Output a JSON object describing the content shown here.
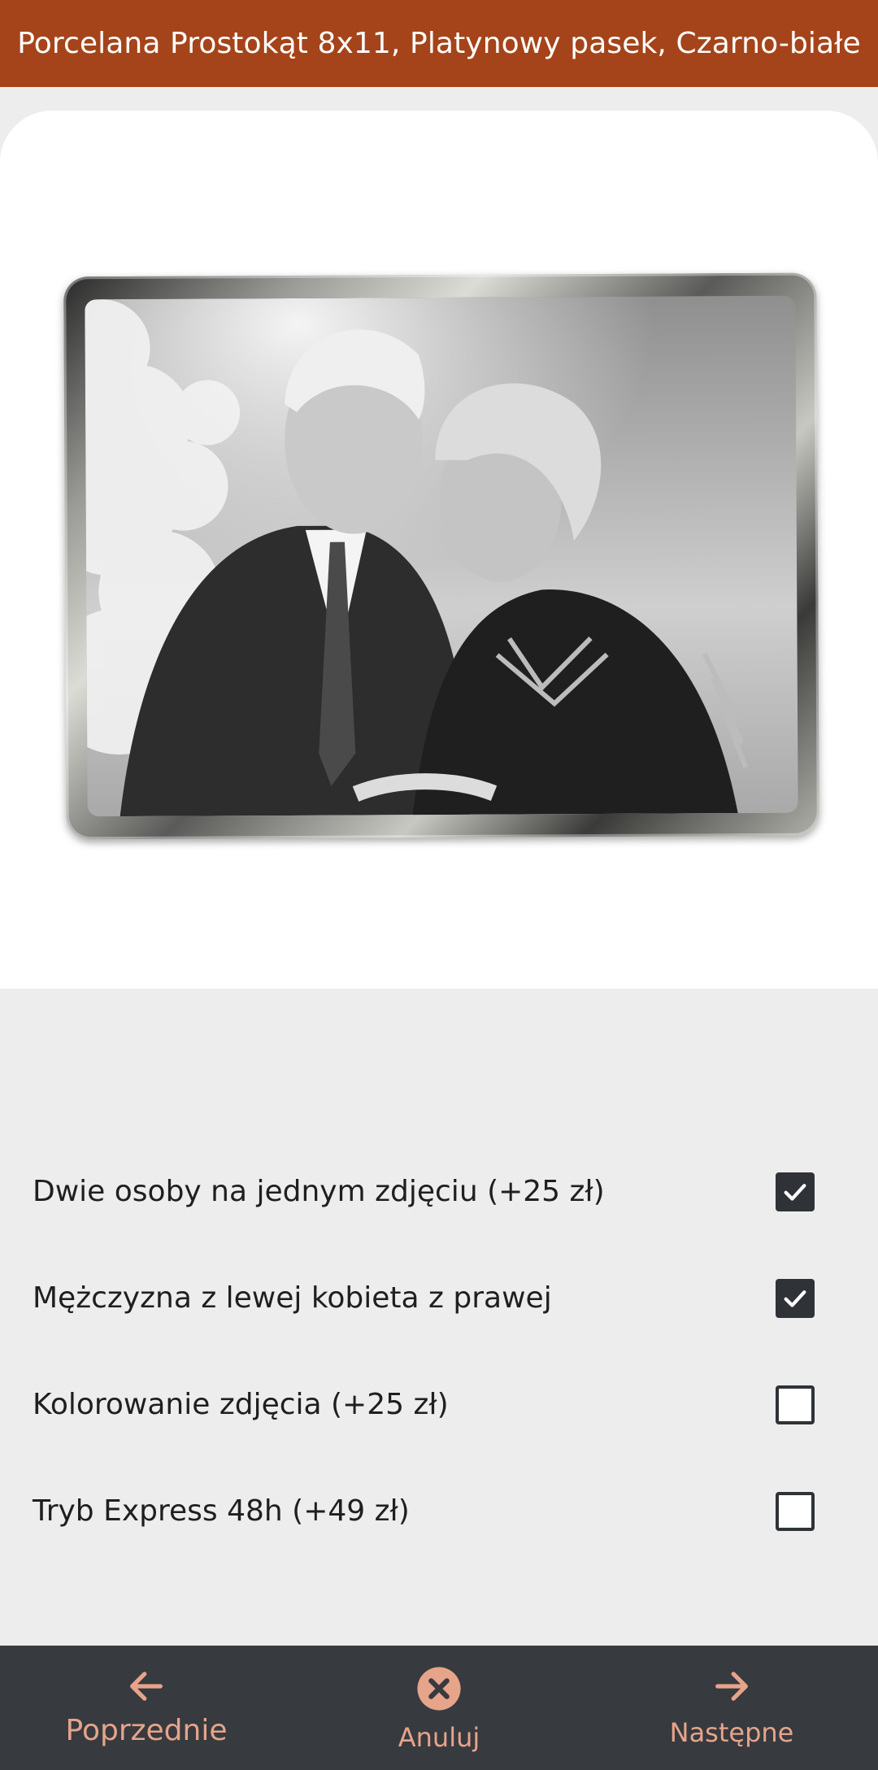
{
  "header": {
    "title": "Porcelana Prostokąt 8x11, Platynowy pasek, Czarno-białe"
  },
  "preview": {
    "frame_style": "platinum",
    "photo_icon": "photo-icon"
  },
  "options": [
    {
      "label": "Dwie osoby na jednym zdjęciu (+25 zł)",
      "checked": true
    },
    {
      "label": "Mężczyzna z lewej kobieta z prawej",
      "checked": true
    },
    {
      "label": "Kolorowanie zdjęcia (+25 zł)",
      "checked": false
    },
    {
      "label": "Tryb Express 48h (+49 zł)",
      "checked": false
    }
  ],
  "footer": {
    "prev_label": "Poprzednie",
    "cancel_label": "Anuluj",
    "next_label": "Następne",
    "prev_icon": "arrow-left-icon",
    "cancel_icon": "close-circle-icon",
    "next_icon": "arrow-right-icon"
  },
  "colors": {
    "accent": "#a5441a",
    "footer_bg": "#373a3f",
    "footer_text": "#e6a48a",
    "checkbox": "#2f3338"
  }
}
